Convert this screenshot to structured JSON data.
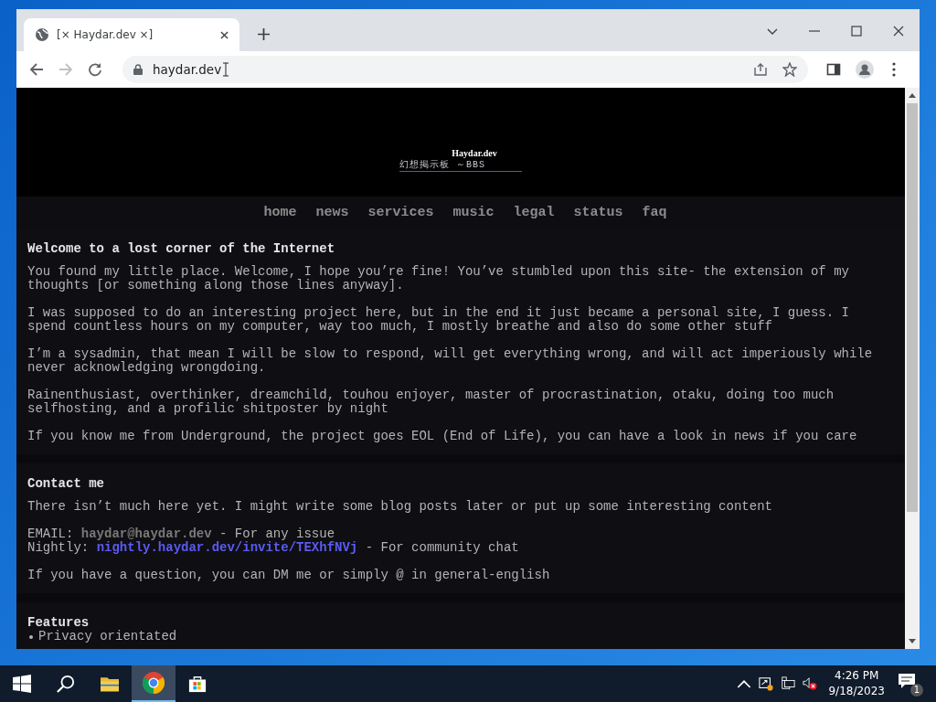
{
  "browser": {
    "tab": {
      "title": "[× Haydar.dev ×]",
      "selected": true
    },
    "address": "haydar.dev"
  },
  "site": {
    "logo": "Haydar.dev",
    "subtitle": "幻想掲示板 ～BBS",
    "nav": [
      {
        "label": "home"
      },
      {
        "label": "news"
      },
      {
        "label": "services"
      },
      {
        "label": "music"
      },
      {
        "label": "legal"
      },
      {
        "label": "status"
      },
      {
        "label": "faq"
      }
    ],
    "sections": [
      {
        "heading": "Welcome to a lost corner of the Internet",
        "paragraphs": [
          "You found my little place. Welcome, I hope you’re fine! You’ve stumbled upon this site- the extension of my thoughts [or something along those lines anyway].",
          "I was supposed to do an interesting project here, but in the end it just became a personal site, I guess. I spend countless hours on my computer, way too much, I mostly breathe and also do some other stuff",
          "I’m a sysadmin, that mean I will be slow to respond, will get everything wrong, and will act imperiously while never acknowledging wrongdoing.",
          "Rainenthusiast, overthinker, dreamchild, touhou enjoyer, master of procrastination, otaku, doing too much selfhosting, and a profilic shitposter by night",
          "If you know me from Underground, the project goes EOL (End of Life), you can have a look in news if you care"
        ]
      },
      {
        "heading": "Contact me",
        "paragraphs": [
          "There isn’t much here yet. I might write some blog posts later or put up some interesting content"
        ],
        "contacts": [
          {
            "label": "EMAIL:",
            "link": "haydar@haydar.dev",
            "kind": "muted",
            "note": "- For any issue"
          },
          {
            "label": "Nightly:",
            "link": "nightly.haydar.dev/invite/TEXhfNVj",
            "kind": "accent",
            "note": "- For community chat"
          }
        ],
        "after": [
          "If you have a question, you can DM me or simply @ in general-english"
        ]
      },
      {
        "heading": "Features",
        "items": [
          "Privacy orientated"
        ]
      }
    ]
  },
  "taskbar": {
    "time": "4:26 PM",
    "date": "9/18/2023",
    "notifications": "1"
  }
}
